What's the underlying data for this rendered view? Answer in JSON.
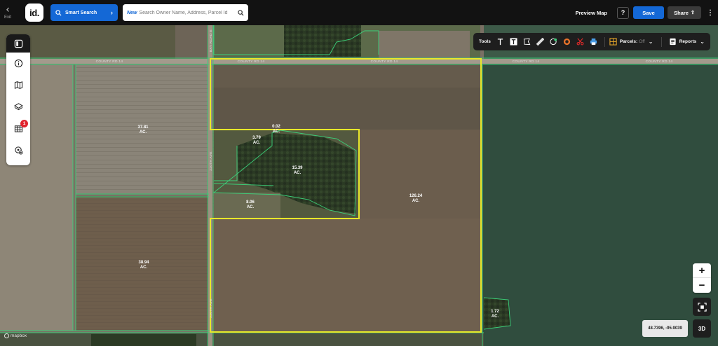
{
  "topbar": {
    "exit_label": "Exit",
    "logo_text": "id.",
    "smart_search_label": "Smart Search",
    "search_new_tag": "New",
    "search_placeholder": "Search Owner Name, Address, Parcel Id",
    "preview_map_label": "Preview Map",
    "help_label": "?",
    "save_label": "Save",
    "share_label": "Share",
    "more_label": "⋮"
  },
  "rail": {
    "items": [
      {
        "name": "panel-toggle-icon"
      },
      {
        "name": "info-icon"
      },
      {
        "name": "map-icon"
      },
      {
        "name": "layers-icon"
      },
      {
        "name": "grid-layers-icon",
        "badge": "1"
      },
      {
        "name": "location-add-icon"
      }
    ]
  },
  "tools": {
    "label": "Tools",
    "icons": [
      "text-icon",
      "text-box-icon",
      "polygon-draw-icon",
      "ruler-icon",
      "globe-pin-icon",
      "buffer-icon",
      "scissors-icon",
      "print-icon"
    ],
    "parcels_label": "Parcels:",
    "parcels_state": "Off",
    "reports_label": "Reports"
  },
  "map": {
    "road_labels": [
      "COUNTY RD 14",
      "COUNTY RD 14",
      "COUNTY RD 14",
      "COUNTY RD 14",
      "COUNTY RD 14",
      "BAY ROAD E",
      "220TH AVE",
      "220TH AVE"
    ],
    "parcels": [
      {
        "acres": "37.81",
        "unit": "AC."
      },
      {
        "acres": "38.94",
        "unit": "AC."
      },
      {
        "acres": "0.02",
        "unit": "AC."
      },
      {
        "acres": "3.79",
        "unit": "AC."
      },
      {
        "acres": "15.39",
        "unit": "AC."
      },
      {
        "acres": "8.06",
        "unit": "AC."
      },
      {
        "acres": "126.24",
        "unit": "AC."
      },
      {
        "acres": "1.72",
        "unit": "AC."
      }
    ],
    "coordinates": "48.7396, -95.9039",
    "attribution": "mapbox",
    "zoom_in": "+",
    "zoom_out": "−",
    "three_d_label": "3D",
    "colors": {
      "parcel_outline": "#3bd17a",
      "selection": "#e8e82a",
      "dark_field": "#2d4a3c"
    }
  }
}
